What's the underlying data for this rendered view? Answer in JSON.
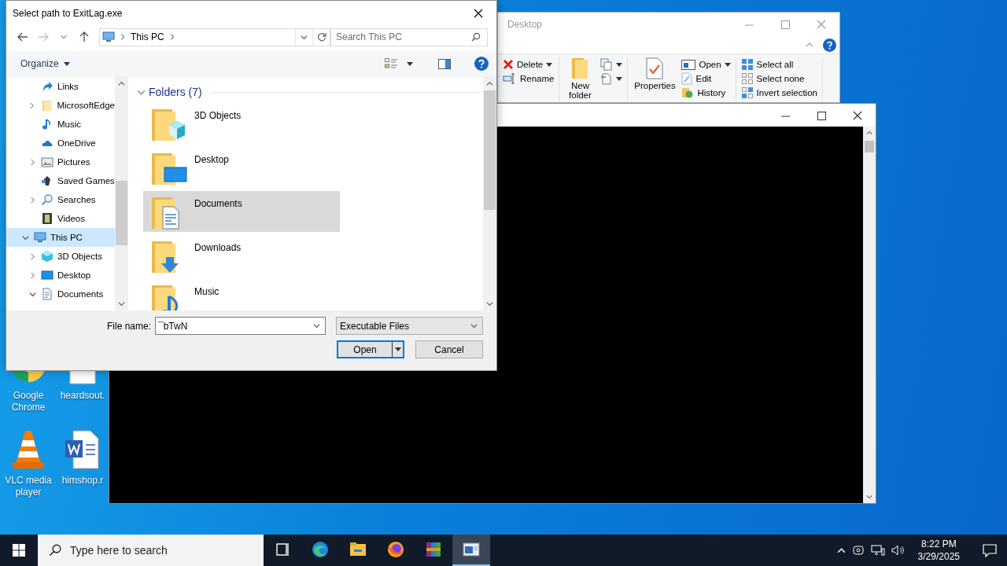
{
  "dialog": {
    "title": "Select path to ExitLag.exe",
    "nav": {
      "back": {
        "disabled": false
      },
      "forward": {
        "disabled": true
      }
    },
    "address": {
      "segments": [
        "This PC"
      ]
    },
    "search": {
      "placeholder": "Search This PC"
    },
    "toolbar": {
      "organize": "Organize"
    },
    "tree": {
      "partial_items": [
        {
          "label": "Links",
          "kind": "link",
          "expandable": false,
          "selected": false
        },
        {
          "label": "MicrosoftEdge",
          "kind": "folder",
          "expandable": true,
          "expanded": false,
          "selected": false
        },
        {
          "label": "Music",
          "kind": "music",
          "expandable": false,
          "selected": false
        },
        {
          "label": "OneDrive",
          "kind": "cloud",
          "expandable": false,
          "selected": false
        },
        {
          "label": "Pictures",
          "kind": "pictures",
          "expandable": true,
          "expanded": false,
          "selected": false
        },
        {
          "label": "Saved Games",
          "kind": "games",
          "expandable": false,
          "selected": false
        },
        {
          "label": "Searches",
          "kind": "search",
          "expandable": true,
          "expanded": false,
          "selected": false
        },
        {
          "label": "Videos",
          "kind": "video",
          "expandable": false,
          "selected": false
        }
      ],
      "items": [
        {
          "label": "This PC",
          "kind": "pc",
          "expandable": true,
          "expanded": true,
          "selected": true,
          "children": [
            {
              "label": "3D Objects",
              "kind": "cube",
              "expandable": true,
              "expanded": false,
              "selected": false
            },
            {
              "label": "Desktop",
              "kind": "desktop",
              "expandable": true,
              "expanded": false,
              "selected": false
            },
            {
              "label": "Documents",
              "kind": "document",
              "expandable": true,
              "expanded": true,
              "selected": false
            }
          ]
        }
      ]
    },
    "content": {
      "group": {
        "label": "Folders (7)",
        "expanded": true
      },
      "items": [
        {
          "label": "3D Objects",
          "kind": "cube",
          "selected": false
        },
        {
          "label": "Desktop",
          "kind": "desktop",
          "selected": false
        },
        {
          "label": "Documents",
          "kind": "document",
          "selected": true
        },
        {
          "label": "Downloads",
          "kind": "downloads",
          "selected": false
        },
        {
          "label": "Music",
          "kind": "music",
          "selected": false
        }
      ]
    },
    "file_name": {
      "label": "File name:",
      "value": "¯bTwN"
    },
    "file_type": {
      "value": "Executable Files"
    },
    "buttons": [
      {
        "label": "Open",
        "kind": "split",
        "default": true
      },
      {
        "label": "Cancel",
        "kind": "plain",
        "default": false
      }
    ]
  },
  "explorer": {
    "title": "Desktop",
    "ribbon": [
      {
        "items": [
          {
            "kind": "delete",
            "label": "Delete",
            "dropdown": true
          },
          {
            "kind": "rename",
            "label": "Rename",
            "dropdown": false
          }
        ]
      },
      {
        "items": [
          {
            "kind": "new_folder",
            "label": "New folder",
            "dropdown": false
          },
          {
            "kind": "copy",
            "dropdown": true
          },
          {
            "kind": "new_item",
            "dropdown": true
          }
        ]
      },
      {
        "items": [
          {
            "kind": "properties",
            "label": "Properties",
            "dropdown": false
          },
          {
            "kind": "open",
            "label": "Open",
            "dropdown": true
          },
          {
            "kind": "edit",
            "label": "Edit",
            "dropdown": false
          },
          {
            "kind": "history",
            "label": "History",
            "dropdown": false
          }
        ]
      },
      {
        "items": [
          {
            "kind": "select_all",
            "label": "Select all",
            "dropdown": false
          },
          {
            "kind": "select_none",
            "label": "Select none",
            "dropdown": false
          },
          {
            "kind": "invert",
            "label": "Invert selection",
            "dropdown": false
          }
        ]
      }
    ]
  },
  "desktop_icons": [
    {
      "label": "Google Chrome",
      "kind": "chrome"
    },
    {
      "label": "heardsout.",
      "kind": "blank"
    },
    {
      "label": "VLC media player",
      "kind": "cone"
    },
    {
      "label": "himshop.r",
      "kind": "word"
    }
  ],
  "taskbar": {
    "search": {
      "placeholder": "Type here to search"
    },
    "apps": [
      {
        "kind": "task_view",
        "active": false
      },
      {
        "kind": "edge",
        "active": false
      },
      {
        "kind": "explorer",
        "active": false
      },
      {
        "kind": "firefox",
        "active": false
      },
      {
        "kind": "winrar",
        "active": false
      },
      {
        "kind": "console",
        "active": true
      }
    ],
    "clock": {
      "time": "8:22 PM",
      "date": "3/29/2025"
    }
  }
}
